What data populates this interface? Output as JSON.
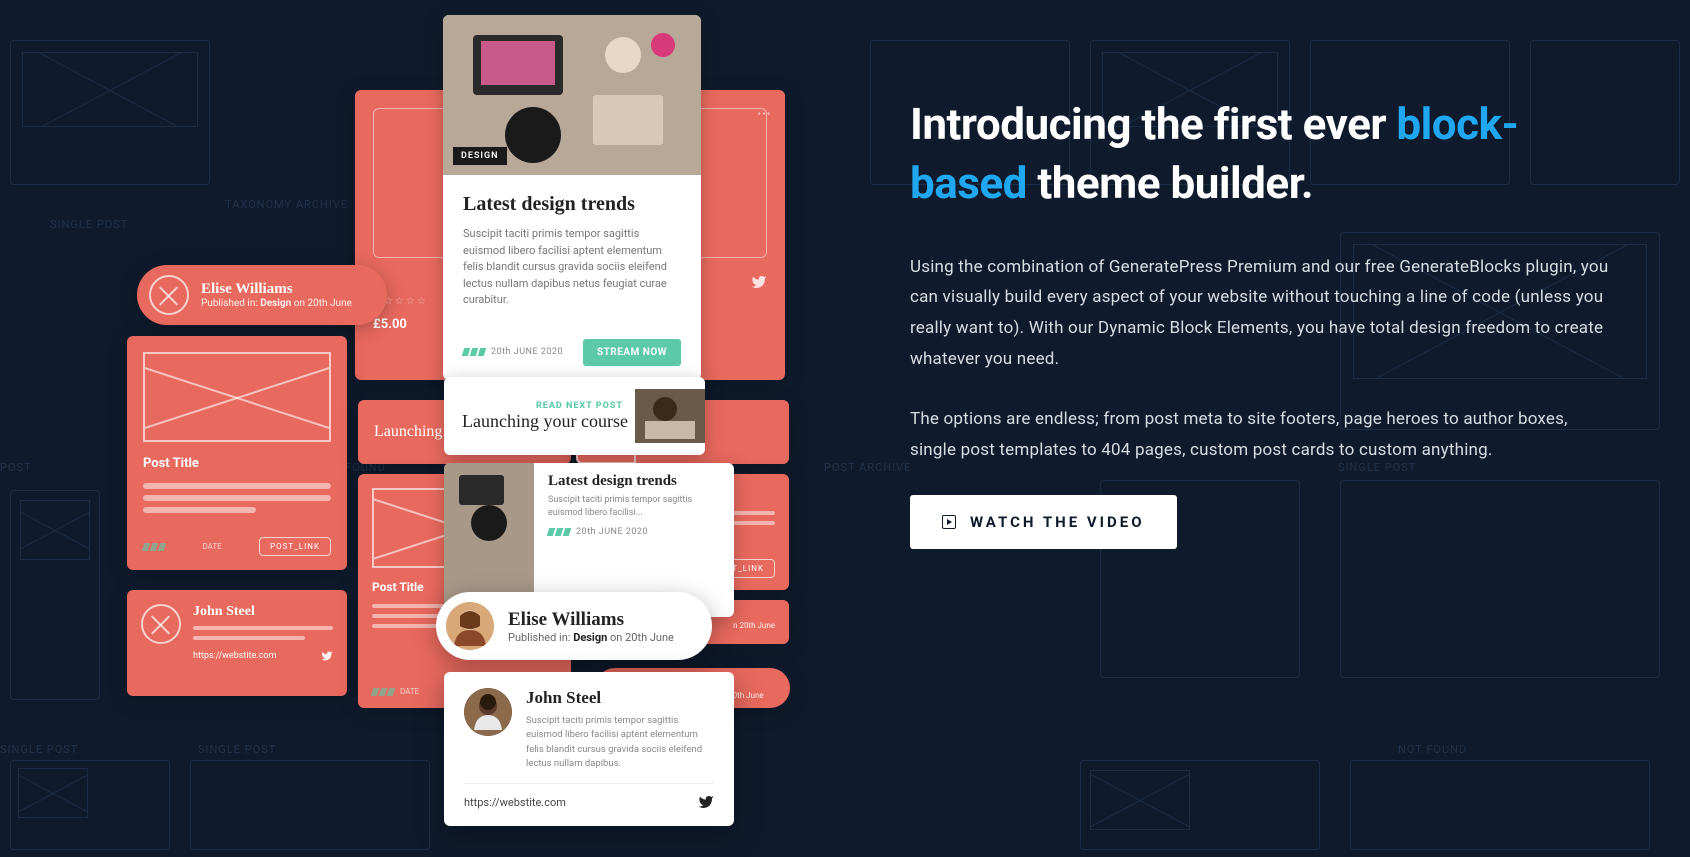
{
  "heading": {
    "pre": "Introducing the first ever ",
    "accent": "block-based",
    "post": " theme builder."
  },
  "para1": "Using the combination of GeneratePress Premium and our free GenerateBlocks plugin, you can visually build every aspect of your website without touching a line of code (unless you really want to). With our Dynamic Block Elements, you have total design freedom to create whatever you need.",
  "para2": "The options are endless; from post meta to site footers, page heroes to author boxes, single post templates to 404 pages, custom post cards to custom anything.",
  "watch_btn": "WATCH THE VIDEO",
  "collage": {
    "elise_pill": {
      "name": "Elise Williams",
      "meta_pre": "Published in: ",
      "meta_cat": "Design",
      "meta_post": " on 20th June"
    },
    "post_title_label": "Post Title",
    "post_link_label": "POST_LINK",
    "john_card": {
      "name": "John Steel",
      "url": "https://webstite.com"
    },
    "price": "£5.00",
    "launching_coral": "Launching y",
    "coral_small_title": "Latest design trends",
    "coral_small_meta": "n 20th June",
    "coral_elise_name": "Elise Williams",
    "feature": {
      "badge": "DESIGN",
      "title": "Latest design trends",
      "desc": "Suscipit taciti primis tempor sagittis euismod libero facilisi aptent elementum felis blandit cursus gravida sociis eleifend lectus nullam dapibus netus feugiat curae curabitur.",
      "date": "20th JUNE 2020",
      "btn": "STREAM NOW"
    },
    "read_next": {
      "tag": "READ NEXT POST",
      "title": "Launching your course"
    },
    "mini": {
      "title": "Latest design trends",
      "desc": "Suscipit taciti primis tempor sagittis euismod libero facilisi...",
      "date": "20th JUNE 2020"
    },
    "author_elise": {
      "name": "Elise Williams",
      "meta_pre": "Published in: ",
      "meta_cat": "Design",
      "meta_post": " on 20th June"
    },
    "profile_john": {
      "name": "John Steel",
      "desc": "Suscipit taciti primis tempor sagittis euismod libero facilisi aptent elementum felis blandit cursus gravida sociis eleifend lectus nullam dapibus.",
      "url": "https://webstite.com"
    }
  },
  "bp_labels": {
    "single_post": "SINGLE POST",
    "taxonomy": "TAXONOMY ARCHIVE",
    "post": "POST",
    "found": "FOUND",
    "post_archive": "POST ARCHIVE",
    "not_found": "NOT FOUND"
  }
}
